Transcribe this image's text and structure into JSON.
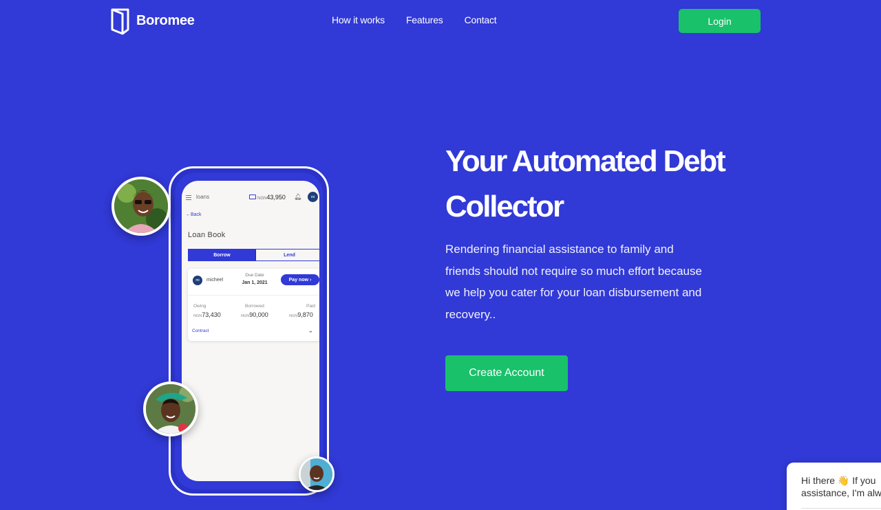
{
  "brand": {
    "name": "Boromee"
  },
  "nav": {
    "links": [
      "How it works",
      "Features",
      "Contact"
    ],
    "login_label": "Login"
  },
  "hero": {
    "title_line1": "Your Automated Debt",
    "title_line2": "Collector",
    "description": "Rendering financial assistance to family and friends should not require so much effort because we help you cater for your loan disbursement and recovery..",
    "cta_label": "Create Account"
  },
  "app_mockup": {
    "menu_label": "loans",
    "currency": "NGN",
    "balance": "43,950",
    "user_initials": "mi",
    "back_label": "Back",
    "section_title": "Loan Book",
    "tabs": [
      "Borrow",
      "Lend"
    ],
    "loan_card": {
      "initials": "mi",
      "name": "micheel",
      "due_label": "Due Date",
      "due_value": "Jan 1, 2021",
      "pay_label": "Pay now",
      "stats": [
        {
          "label": "Owing",
          "currency": "NGN",
          "value": "73,430"
        },
        {
          "label": "Borrowed",
          "currency": "NGN",
          "value": "90,000"
        },
        {
          "label": "Paid",
          "currency": "NGN",
          "value": "9,870"
        }
      ],
      "contract_label": "Contract"
    }
  },
  "chat": {
    "line1": "Hi there 👋 If you",
    "line2": "assistance, I'm alw"
  },
  "colors": {
    "background": "#3139d6",
    "accent_green": "#19c16a",
    "white": "#ffffff"
  }
}
